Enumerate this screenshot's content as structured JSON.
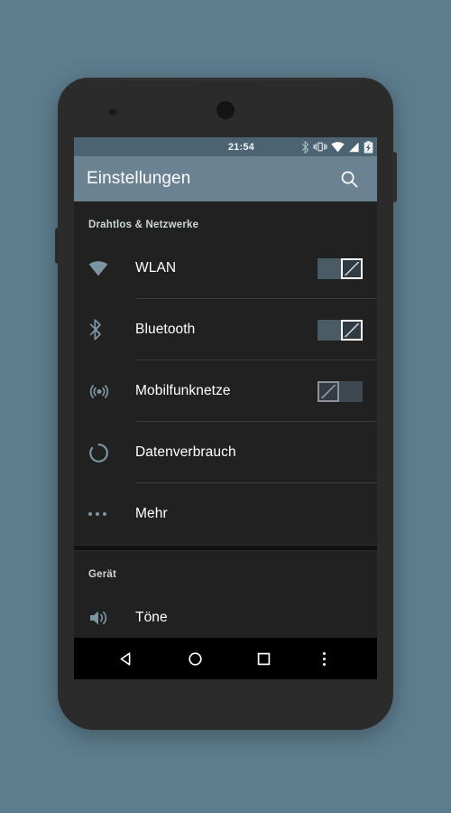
{
  "theme": {
    "page_background": "#5d7d8e",
    "phone_body": "#2b2b2b",
    "status_bar": "#4c6472",
    "action_bar": "#6b8292",
    "list_background": "#212121",
    "accent_icon": "#7d95a3",
    "text_primary": "#ffffff",
    "nav_bar": "#000000"
  },
  "status_bar": {
    "clock": "21:54",
    "icons": [
      {
        "name": "bluetooth-icon",
        "label": "Bluetooth aktiv"
      },
      {
        "name": "vibrate-icon",
        "label": "Vibration"
      },
      {
        "name": "wifi-icon",
        "label": "WLAN verbunden"
      },
      {
        "name": "cell-signal-icon",
        "label": "Mobilfunksignal"
      },
      {
        "name": "battery-charging-icon",
        "label": "Akku wird geladen"
      }
    ]
  },
  "action_bar": {
    "title": "Einstellungen",
    "search_icon": "search-icon",
    "search_label": "Suchen"
  },
  "sections": [
    {
      "header": "Drahtlos & Netzwerke",
      "rows": [
        {
          "icon": "wifi-icon",
          "label": "WLAN",
          "control": "switch",
          "switch_state": "on"
        },
        {
          "icon": "bluetooth-icon",
          "label": "Bluetooth",
          "control": "switch",
          "switch_state": "on"
        },
        {
          "icon": "cell-network-icon",
          "label": "Mobilfunknetze",
          "control": "switch",
          "switch_state": "off"
        },
        {
          "icon": "data-usage-icon",
          "label": "Datenverbrauch",
          "control": "none",
          "switch_state": ""
        },
        {
          "icon": "more-icon",
          "label": "Mehr",
          "control": "none",
          "switch_state": ""
        }
      ]
    },
    {
      "header": "Gerät",
      "rows": [
        {
          "icon": "sound-icon",
          "label": "Töne",
          "control": "none",
          "switch_state": ""
        }
      ]
    }
  ],
  "nav_bar": {
    "back": "back-icon",
    "home": "home-icon",
    "recents": "recents-icon",
    "overflow": "overflow-menu-icon"
  }
}
